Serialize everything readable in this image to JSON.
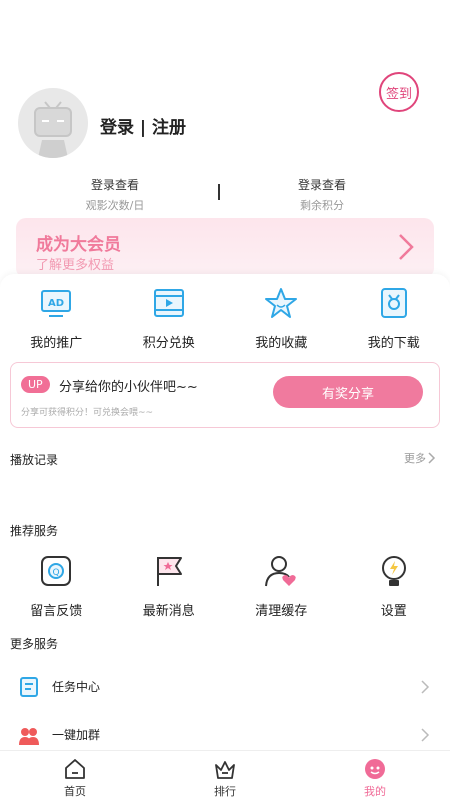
{
  "profile": {
    "signin_label": "签到",
    "login_title": "登录 | 注册",
    "stats": [
      {
        "value": "登录查看",
        "label": "观影次数/日"
      },
      {
        "value": "登录查看",
        "label": "剩余积分"
      }
    ]
  },
  "vip": {
    "title": "成为大会员",
    "subtitle": "了解更多权益"
  },
  "quick_actions": [
    {
      "label": "我的推广",
      "icon": "ad-icon"
    },
    {
      "label": "积分兑换",
      "icon": "film-icon"
    },
    {
      "label": "我的收藏",
      "icon": "star-icon"
    },
    {
      "label": "我的下载",
      "icon": "download-icon"
    }
  ],
  "share": {
    "badge": "UP",
    "title": "分享给你的小伙伴吧~~",
    "desc": "分享可获得积分！可兑换会喂~~",
    "button": "有奖分享"
  },
  "history": {
    "title": "播放记录",
    "more": "更多"
  },
  "recommend": {
    "title": "推荐服务",
    "items": [
      {
        "label": "留言反馈",
        "icon": "feedback-icon"
      },
      {
        "label": "最新消息",
        "icon": "flag-icon"
      },
      {
        "label": "清理缓存",
        "icon": "user-heart-icon"
      },
      {
        "label": "设置",
        "icon": "bulb-icon"
      }
    ]
  },
  "more_services": {
    "title": "更多服务",
    "items": [
      {
        "label": "任务中心",
        "icon": "task-icon"
      },
      {
        "label": "一键加群",
        "icon": "group-icon"
      }
    ]
  },
  "tabbar": {
    "tabs": [
      {
        "label": "首页",
        "icon": "home-icon"
      },
      {
        "label": "排行",
        "icon": "crown-icon"
      },
      {
        "label": "我的",
        "icon": "mine-icon"
      }
    ],
    "active_index": 2
  },
  "colors": {
    "accent": "#f06b97",
    "signin": "#e0457b",
    "icon_blue": "#2fa7e6"
  }
}
